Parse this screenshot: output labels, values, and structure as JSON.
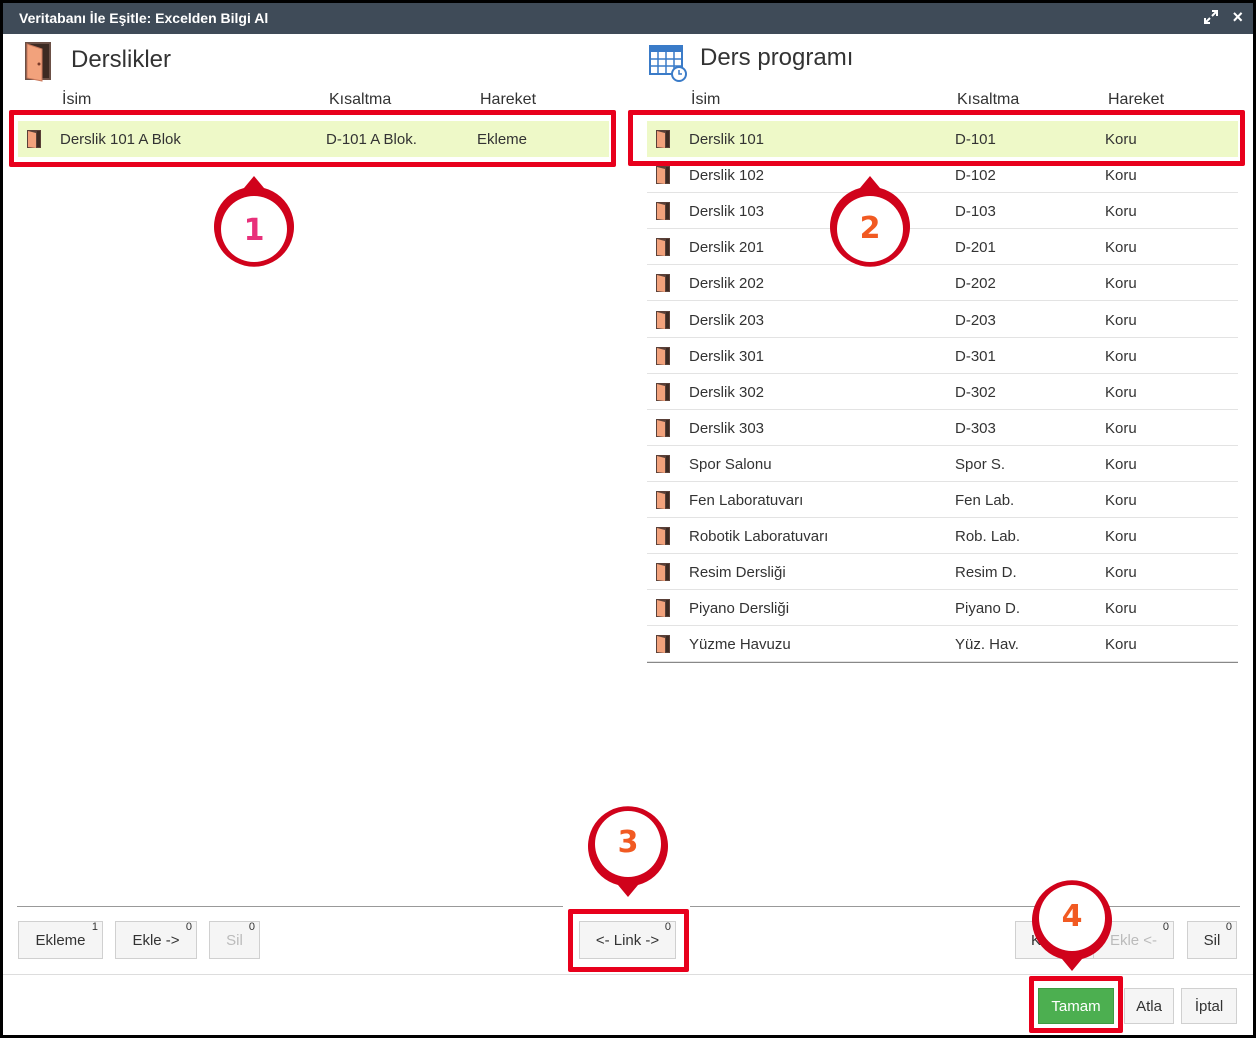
{
  "window": {
    "title": "Veritabanı İle Eşitle: Excelden Bilgi Al",
    "close_glyph": "×"
  },
  "left": {
    "title": "Derslikler",
    "columns": {
      "name": "İsim",
      "abbr": "Kısaltma",
      "action": "Hareket"
    },
    "rows": [
      {
        "name": "Derslik 101 A Blok",
        "abbr": "D-101 A Blok.",
        "action": "Ekleme"
      }
    ]
  },
  "right": {
    "title": "Ders programı",
    "columns": {
      "name": "İsim",
      "abbr": "Kısaltma",
      "action": "Hareket"
    },
    "rows": [
      {
        "name": "Derslik 101",
        "abbr": "D-101",
        "action": "Koru"
      },
      {
        "name": "Derslik 102",
        "abbr": "D-102",
        "action": "Koru"
      },
      {
        "name": "Derslik 103",
        "abbr": "D-103",
        "action": "Koru"
      },
      {
        "name": "Derslik 201",
        "abbr": "D-201",
        "action": "Koru"
      },
      {
        "name": "Derslik 202",
        "abbr": "D-202",
        "action": "Koru"
      },
      {
        "name": "Derslik 203",
        "abbr": "D-203",
        "action": "Koru"
      },
      {
        "name": "Derslik 301",
        "abbr": "D-301",
        "action": "Koru"
      },
      {
        "name": "Derslik 302",
        "abbr": "D-302",
        "action": "Koru"
      },
      {
        "name": "Derslik 303",
        "abbr": "D-303",
        "action": "Koru"
      },
      {
        "name": "Spor Salonu",
        "abbr": "Spor S.",
        "action": "Koru"
      },
      {
        "name": "Fen Laboratuvarı",
        "abbr": "Fen Lab.",
        "action": "Koru"
      },
      {
        "name": "Robotik Laboratuvarı",
        "abbr": "Rob. Lab.",
        "action": "Koru"
      },
      {
        "name": "Resim Dersliği",
        "abbr": "Resim D.",
        "action": "Koru"
      },
      {
        "name": "Piyano Dersliği",
        "abbr": "Piyano D.",
        "action": "Koru"
      },
      {
        "name": "Yüzme Havuzu",
        "abbr": "Yüz. Hav.",
        "action": "Koru"
      }
    ]
  },
  "left_buttons": {
    "ekleme": {
      "label": "Ekleme",
      "count": "1"
    },
    "ekle": {
      "label": "Ekle ->",
      "count": "0"
    },
    "sil": {
      "label": "Sil",
      "count": "0"
    }
  },
  "center_buttons": {
    "link": {
      "label": "<- Link ->",
      "count": "0"
    }
  },
  "right_buttons": {
    "koru": {
      "label": "K",
      "count": ""
    },
    "ekle": {
      "label": "Ekle <-",
      "count": "0"
    },
    "sil": {
      "label": "Sil",
      "count": "0"
    }
  },
  "footer": {
    "ok": "Tamam",
    "skip": "Atla",
    "cancel": "İptal"
  },
  "markers": [
    "1",
    "2",
    "3",
    "4"
  ],
  "colors": {
    "titlebar": "#3f4b58",
    "selected_row": "#eef9c8",
    "highlight": "#e8001c",
    "ok_button": "#4caf50"
  }
}
